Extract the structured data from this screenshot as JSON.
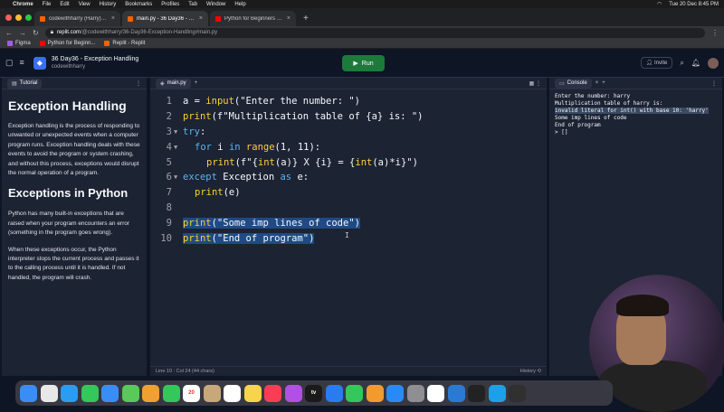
{
  "menubar": {
    "items": [
      "Chrome",
      "File",
      "Edit",
      "View",
      "History",
      "Bookmarks",
      "Profiles",
      "Tab",
      "Window",
      "Help"
    ],
    "datetime": "Tue 20 Dec 8:45 PM"
  },
  "browser": {
    "tabs": [
      {
        "title": "codewithharry (Harry) - Replit",
        "color": "#f26207"
      },
      {
        "title": "main.py - 36 Day36 - Exception",
        "color": "#f26207"
      },
      {
        "title": "Python for Beginners (Full Co",
        "color": "#ff0000"
      }
    ],
    "url_host": "replit.com",
    "url_rest": "/@codewithharry/36-Day36-Exception-Handling#main.py",
    "bookmarks": [
      "Figma",
      "Python for Beginn...",
      "Replit - Replit"
    ]
  },
  "header": {
    "project_name": "36 Day36 - Exception Handling",
    "owner": "codewithharry",
    "run_label": "Run",
    "invite_label": "Invite"
  },
  "tutorial": {
    "tab_label": "Tutorial",
    "heading1": "Exception Handling",
    "para1": "Exception handling is the process of responding to unwanted or unexpected events when a computer program runs. Exception handling deals with these events to avoid the program or system crashing, and without this process, exceptions would disrupt the normal operation of a program.",
    "heading2": "Exceptions in Python",
    "para2": "Python has many built-in exceptions that are raised when your program encounters an error (something in the program goes wrong).",
    "para3": "When these exceptions occur, the Python interpreter stops the current process and passes it to the calling process until it is handled. If not handled, the program will crash."
  },
  "editor": {
    "tab_label": "main.py",
    "lines": [
      {
        "n": "1",
        "fold": "",
        "indent": 0,
        "hl": false,
        "tokens": [
          {
            "t": "a = ",
            "c": "#f5f9fc"
          },
          {
            "t": "input",
            "c": "#ffcf35"
          },
          {
            "t": "(",
            "c": "#f5f9fc"
          },
          {
            "t": "\"Enter the number: \"",
            "c": "#f5f9fc"
          },
          {
            "t": ")",
            "c": "#f5f9fc"
          }
        ]
      },
      {
        "n": "2",
        "fold": "",
        "indent": 0,
        "hl": false,
        "tokens": [
          {
            "t": "print",
            "c": "#ffcf35"
          },
          {
            "t": "(f\"Multiplication table of {a} is: \")",
            "c": "#f5f9fc"
          }
        ]
      },
      {
        "n": "3",
        "fold": "▼",
        "indent": 0,
        "hl": false,
        "tokens": [
          {
            "t": "try",
            "c": "#56b6f2"
          },
          {
            "t": ":",
            "c": "#f5f9fc"
          }
        ]
      },
      {
        "n": "4",
        "fold": "▼",
        "indent": 1,
        "hl": false,
        "tokens": [
          {
            "t": "for",
            "c": "#56b6f2"
          },
          {
            "t": " i ",
            "c": "#f5f9fc"
          },
          {
            "t": "in",
            "c": "#56b6f2"
          },
          {
            "t": " ",
            "c": "#f5f9fc"
          },
          {
            "t": "range",
            "c": "#ffcf35"
          },
          {
            "t": "(1, 11):",
            "c": "#f5f9fc"
          }
        ]
      },
      {
        "n": "5",
        "fold": "",
        "indent": 2,
        "hl": false,
        "tokens": [
          {
            "t": "print",
            "c": "#ffcf35"
          },
          {
            "t": "(f\"{",
            "c": "#f5f9fc"
          },
          {
            "t": "int",
            "c": "#ffcf35"
          },
          {
            "t": "(a)} X {i} = {",
            "c": "#f5f9fc"
          },
          {
            "t": "int",
            "c": "#ffcf35"
          },
          {
            "t": "(a)*i}\")",
            "c": "#f5f9fc"
          }
        ]
      },
      {
        "n": "6",
        "fold": "▼",
        "indent": 0,
        "hl": false,
        "tokens": [
          {
            "t": "except",
            "c": "#56b6f2"
          },
          {
            "t": " Exception ",
            "c": "#f5f9fc"
          },
          {
            "t": "as",
            "c": "#56b6f2"
          },
          {
            "t": " e:",
            "c": "#f5f9fc"
          }
        ]
      },
      {
        "n": "7",
        "fold": "",
        "indent": 1,
        "hl": false,
        "tokens": [
          {
            "t": "print",
            "c": "#ffcf35"
          },
          {
            "t": "(e)",
            "c": "#f5f9fc"
          }
        ]
      },
      {
        "n": "8",
        "fold": "",
        "indent": 0,
        "hl": false,
        "tokens": []
      },
      {
        "n": "9",
        "fold": "",
        "indent": 0,
        "hl": true,
        "tokens": [
          {
            "t": "print",
            "c": "#ffcf35"
          },
          {
            "t": "(\"Some imp lines of code\")",
            "c": "#f5f9fc"
          }
        ]
      },
      {
        "n": "10",
        "fold": "",
        "indent": 0,
        "hl": true,
        "tokens": [
          {
            "t": "print",
            "c": "#ffcf35"
          },
          {
            "t": "(\"End of program\")",
            "c": "#f5f9fc"
          }
        ]
      }
    ],
    "status_text": "Line 10 : Col 24 (44 chars)",
    "history_label": "History"
  },
  "console": {
    "tab_label": "Console",
    "lines": [
      {
        "text": "Enter the number: harry",
        "err": false
      },
      {
        "text": "Multiplication table of harry is:",
        "err": false
      },
      {
        "text": "invalid literal for int() with base 10: 'harry'",
        "err": true
      },
      {
        "text": "Some imp lines of code",
        "err": false
      },
      {
        "text": "End of program",
        "err": false
      },
      {
        "text": "> []",
        "err": false
      }
    ]
  },
  "dock": {
    "apps": [
      {
        "name": "finder",
        "color": "#3a8df5"
      },
      {
        "name": "launchpad",
        "color": "#e8e8e8"
      },
      {
        "name": "safari",
        "color": "#2a9cf2"
      },
      {
        "name": "messages",
        "color": "#34c759"
      },
      {
        "name": "mail",
        "color": "#3a8df5"
      },
      {
        "name": "maps",
        "color": "#5ac85a"
      },
      {
        "name": "photos",
        "color": "#f0a030"
      },
      {
        "name": "facetime",
        "color": "#34c759"
      },
      {
        "name": "calendar",
        "color": "#ffffff",
        "label": "20"
      },
      {
        "name": "contacts",
        "color": "#c8a878"
      },
      {
        "name": "reminders",
        "color": "#ffffff"
      },
      {
        "name": "notes",
        "color": "#f7d44a"
      },
      {
        "name": "music",
        "color": "#fa3c55"
      },
      {
        "name": "podcasts",
        "color": "#b150e2"
      },
      {
        "name": "apple-tv",
        "color": "#1a1a1a",
        "label": "tv"
      },
      {
        "name": "keynote",
        "color": "#2a7af0"
      },
      {
        "name": "numbers",
        "color": "#34c759"
      },
      {
        "name": "pages",
        "color": "#f29a30"
      },
      {
        "name": "app-store",
        "color": "#2a8af5"
      },
      {
        "name": "system-settings",
        "color": "#8e8e93"
      },
      {
        "name": "chrome",
        "color": "#ffffff"
      },
      {
        "name": "vscode",
        "color": "#2a7ad4"
      },
      {
        "name": "terminal",
        "color": "#222222"
      },
      {
        "name": "skype",
        "color": "#1ea0e8"
      },
      {
        "name": "obs",
        "color": "#303030"
      }
    ]
  }
}
